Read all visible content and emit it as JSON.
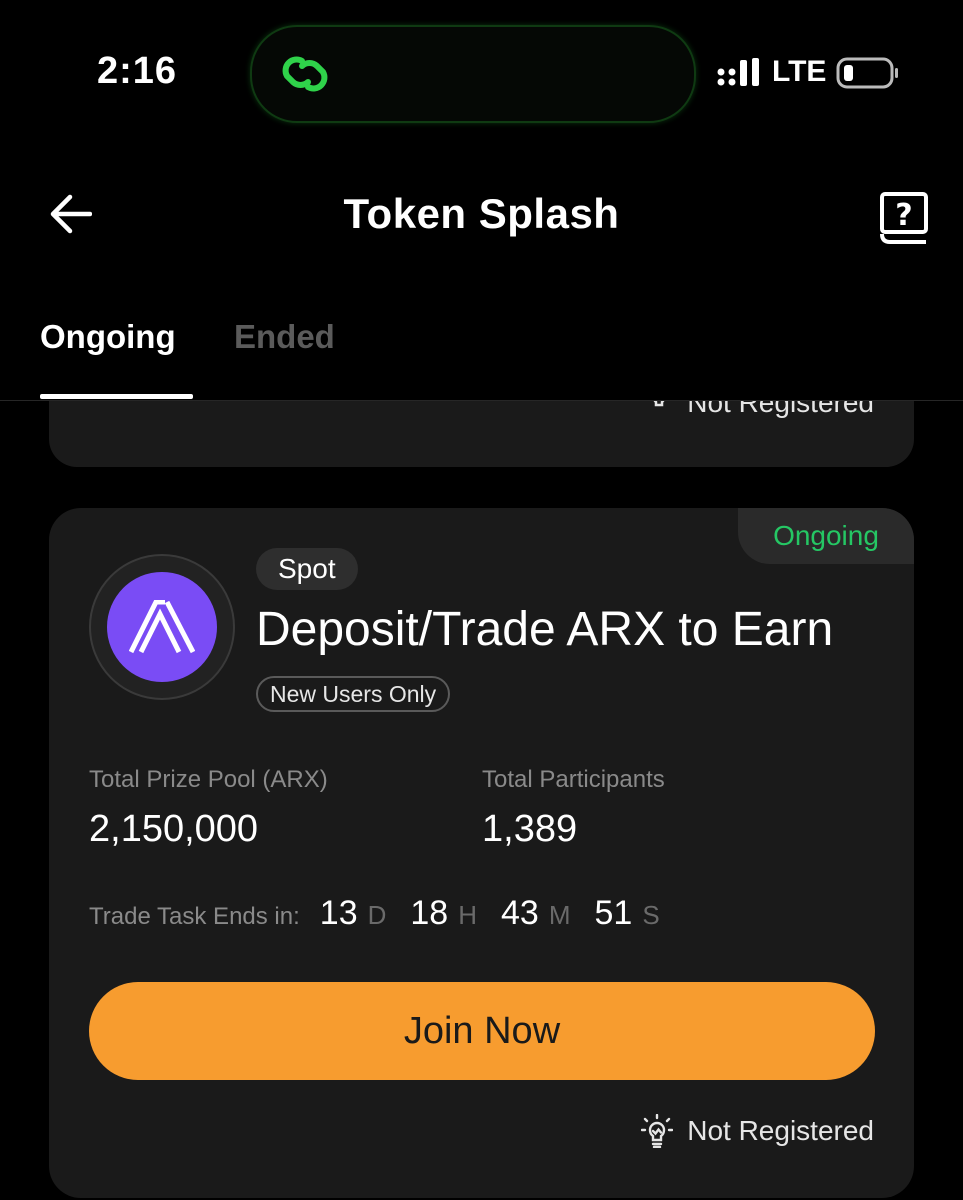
{
  "status_bar": {
    "time": "2:16",
    "network": "LTE",
    "icons": [
      "link-icon",
      "signal-icon",
      "battery-icon"
    ],
    "accent": "#25c764"
  },
  "header": {
    "title": "Token Splash",
    "back_icon": "arrow-left-icon",
    "help_icon": "question-book-icon"
  },
  "tabs": [
    {
      "label": "Ongoing",
      "active": true
    },
    {
      "label": "Ended",
      "active": false
    }
  ],
  "previous_card": {
    "registration_status": "Not Registered"
  },
  "card": {
    "status": "Ongoing",
    "status_color": "#25c764",
    "logo_icon": "arx-logo-icon",
    "logo_color": "#7a4cf5",
    "tag": "Spot",
    "title": "Deposit/Trade ARX to Earn",
    "audience": "New Users Only",
    "prize_pool_label": "Total Prize Pool (ARX)",
    "prize_pool_value": "2,150,000",
    "participants_label": "Total Participants",
    "participants_value": "1,389",
    "countdown": {
      "label": "Trade Task Ends in:",
      "days": "13",
      "days_unit": "D",
      "hours": "18",
      "hours_unit": "H",
      "minutes": "43",
      "minutes_unit": "M",
      "seconds": "51",
      "seconds_unit": "S"
    },
    "button_label": "Join Now",
    "button_color": "#f79c2f",
    "registration_status": "Not Registered",
    "registration_icon": "lightbulb-icon"
  }
}
